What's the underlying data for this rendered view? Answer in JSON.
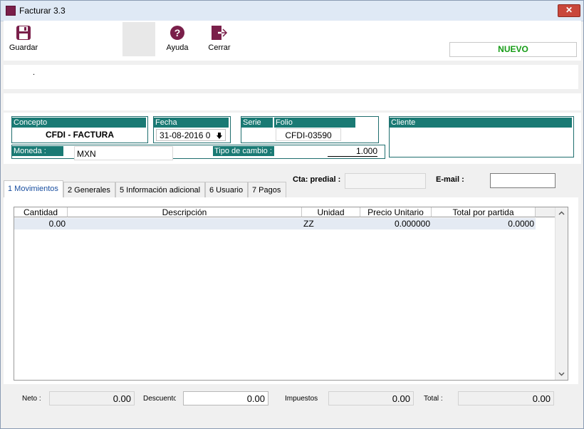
{
  "window": {
    "title": "Facturar 3.3",
    "close_glyph": "✕"
  },
  "toolbar": {
    "guardar": "Guardar",
    "ayuda": "Ayuda",
    "cerrar": "Cerrar",
    "status": "NUEVO",
    "status_color": "#169c16"
  },
  "band": {
    "dot": "."
  },
  "header": {
    "concepto_label": "Concepto",
    "concepto_value": "CFDI - FACTURA",
    "fecha_label": "Fecha",
    "fecha_value": "31-08-2016 0",
    "serie_label": "Serie",
    "folio_label": "Folio",
    "folio_value": "CFDI-03590",
    "cliente_label": "Cliente",
    "moneda_label": "Moneda :",
    "moneda_value": "MXN",
    "tipo_cambio_label": "Tipo de cambio :",
    "tipo_cambio_value": "1.000",
    "accent_color": "#1a7a74"
  },
  "tabs": [
    {
      "label": "1 Movimientos",
      "active": true
    },
    {
      "label": "2 Generales"
    },
    {
      "label": "5 Información adicional"
    },
    {
      "label": "6 Usuario"
    },
    {
      "label": "7 Pagos"
    }
  ],
  "extra": {
    "cta_predial_label": "Cta: predial :",
    "email_label": "E-mail :",
    "cta_predial_value": "",
    "email_value": ""
  },
  "grid": {
    "columns": [
      "Cantidad",
      "Descripción",
      "Unidad",
      "Precio Unitario",
      "Total por partida"
    ],
    "rows": [
      {
        "cantidad": "0.00",
        "descripcion": "",
        "unidad": "ZZ",
        "precio": "0.000000",
        "total": "0.0000"
      }
    ]
  },
  "totals": {
    "neto_label": "Neto :",
    "neto_value": "0.00",
    "descuento_label": "Descuento",
    "descuento_value": "0.00",
    "impuestos_label": "Impuestos",
    "impuestos_value": "0.00",
    "total_label": "Total :",
    "total_value": "0.00"
  },
  "icons": [
    "save-icon",
    "help-icon",
    "exit-icon",
    "arrow-down-icon",
    "scroll-up-icon",
    "scroll-down-icon"
  ]
}
